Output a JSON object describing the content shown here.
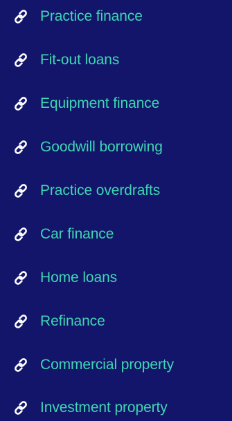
{
  "colors": {
    "background": "#12156a",
    "link_text": "#3fd6b2",
    "icon": "#ffffff"
  },
  "links": [
    {
      "label": "Practice finance",
      "icon": "link-icon"
    },
    {
      "label": "Fit-out loans",
      "icon": "link-icon"
    },
    {
      "label": "Equipment finance",
      "icon": "link-icon"
    },
    {
      "label": "Goodwill borrowing",
      "icon": "link-icon"
    },
    {
      "label": "Practice overdrafts",
      "icon": "link-icon"
    },
    {
      "label": "Car finance",
      "icon": "link-icon"
    },
    {
      "label": "Home loans",
      "icon": "link-icon"
    },
    {
      "label": "Refinance",
      "icon": "link-icon"
    },
    {
      "label": "Commercial property",
      "icon": "link-icon"
    },
    {
      "label": "Investment property",
      "icon": "link-icon"
    }
  ]
}
